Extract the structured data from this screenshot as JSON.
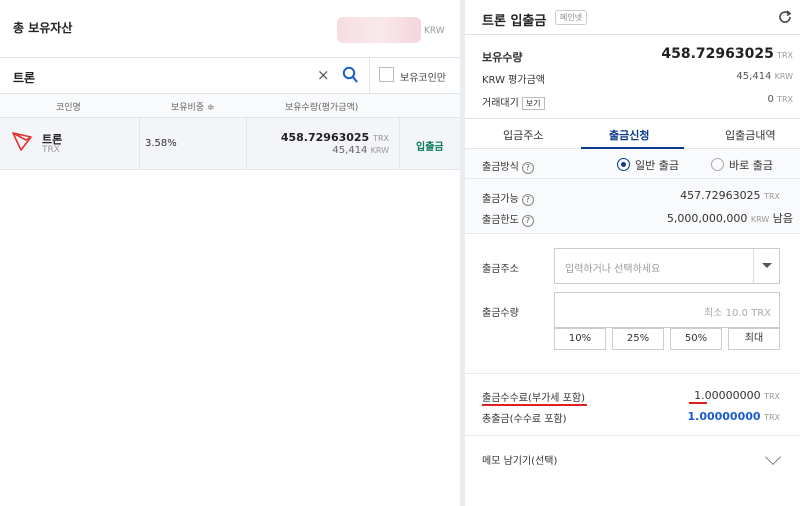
{
  "assets": {
    "title": "총 보유자산",
    "currency": "KRW"
  },
  "search": {
    "value": "트론",
    "clear_icon": "×",
    "holding_only_label": "보유코인만"
  },
  "table": {
    "headers": [
      "코인명",
      "보유비중 ≑",
      "보유수량(평가금액)"
    ],
    "row": {
      "name": "트론",
      "symbol": "TRX",
      "share": "3.58%",
      "amount": "458.72963025",
      "amount_unit": "TRX",
      "krw_value": "45,414",
      "krw_unit": "KRW",
      "action": "입출금"
    }
  },
  "panel": {
    "title": "트론 입출금",
    "badge": "메인넷",
    "holding_label": "보유수량",
    "holding_value": "458.72963025",
    "holding_unit": "TRX",
    "krw_label": "KRW 평가금액",
    "krw_value": "45,414",
    "krw_unit": "KRW",
    "pending_label": "거래대기",
    "pending_btn": "보기",
    "pending_value": "0",
    "pending_unit": "TRX",
    "tabs": [
      "입금주소",
      "출금신청",
      "입출금내역"
    ],
    "method_label": "출금방식",
    "method_normal": "일반 출금",
    "method_instant": "바로 출금",
    "avail_label": "출금가능",
    "avail_value": "457.72963025",
    "avail_unit": "TRX",
    "limit_label": "출금한도",
    "limit_value": "5,000,000,000",
    "limit_unit": "KRW",
    "limit_suffix": "남음",
    "addr_label": "출금주소",
    "addr_placeholder": "입력하거나 선택하세요",
    "qty_label": "출금수량",
    "qty_placeholder": "최소 10.0 TRX",
    "pct_buttons": [
      "10%",
      "25%",
      "50%",
      "최대"
    ],
    "fee_label": "출금수수료(부가세 포함)",
    "fee_value": "1.00000000",
    "fee_unit": "TRX",
    "total_label": "총출금(수수료 포함)",
    "total_value": "1.00000000",
    "total_unit": "TRX",
    "memo_label": "메모 남기기(선택)",
    "question": "?"
  }
}
